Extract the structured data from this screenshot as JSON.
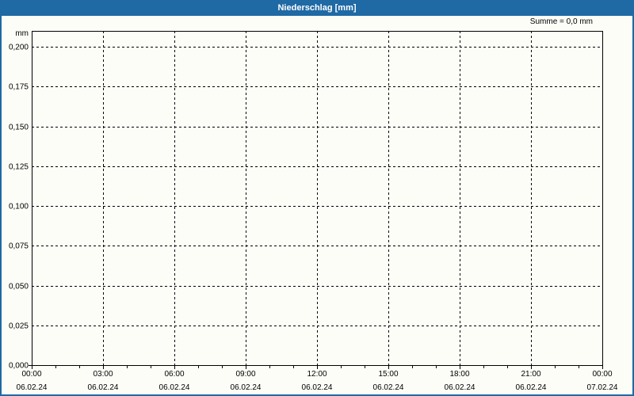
{
  "window": {
    "title": "Niederschlag [mm]"
  },
  "colors": {
    "header_bg": "#1f69a5",
    "header_text": "#ffffff",
    "background": "#fdfdf8",
    "axis": "#000000",
    "grid": "#000000"
  },
  "chart_data": {
    "type": "bar",
    "title": "Niederschlag [mm]",
    "unit": "mm",
    "annotation": "Summe = 0,0 mm",
    "grid": "dashed",
    "legend": "none",
    "series": [],
    "values": [],
    "total_precipitation_mm": "0,0",
    "x_axis": {
      "start": "06.02.24 00:00",
      "end": "07.02.24 00:00",
      "hours_total": 24,
      "major_tick_hours": 3,
      "minor_tick_hours": 1,
      "ticks": [
        {
          "time": "00:00",
          "date": "06.02.24"
        },
        {
          "time": "03:00",
          "date": "06.02.24"
        },
        {
          "time": "06:00",
          "date": "06.02.24"
        },
        {
          "time": "09:00",
          "date": "06.02.24"
        },
        {
          "time": "12:00",
          "date": "06.02.24"
        },
        {
          "time": "15:00",
          "date": "06.02.24"
        },
        {
          "time": "18:00",
          "date": "06.02.24"
        },
        {
          "time": "21:00",
          "date": "06.02.24"
        },
        {
          "time": "00:00",
          "date": "07.02.24"
        }
      ]
    },
    "y_axis": {
      "min": 0,
      "max": 0.21,
      "ticks": [
        {
          "value": 0.0,
          "label": "0,000"
        },
        {
          "value": 0.025,
          "label": "0,025"
        },
        {
          "value": 0.05,
          "label": "0,050"
        },
        {
          "value": 0.075,
          "label": "0,075"
        },
        {
          "value": 0.1,
          "label": "0,100"
        },
        {
          "value": 0.125,
          "label": "0,125"
        },
        {
          "value": 0.15,
          "label": "0,150"
        },
        {
          "value": 0.175,
          "label": "0,175"
        },
        {
          "value": 0.2,
          "label": "0,200"
        }
      ]
    }
  }
}
